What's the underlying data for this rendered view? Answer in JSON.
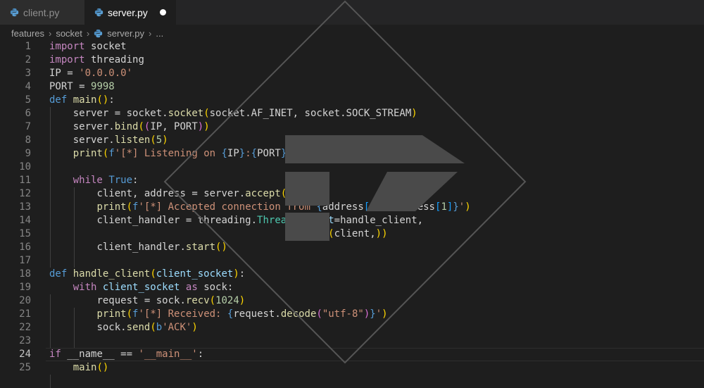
{
  "tabs": [
    {
      "label": "client.py",
      "active": false,
      "icon": "python-icon"
    },
    {
      "label": "server.py",
      "active": true,
      "icon": "python-icon",
      "unsaved": true
    }
  ],
  "breadcrumb": [
    "features",
    "socket",
    "server.py",
    "..."
  ],
  "current_line": 24,
  "colors": {
    "keyword": "#c586c0",
    "def": "#569cd6",
    "function": "#dcdcaa",
    "string": "#ce9178",
    "number": "#b5cea8"
  },
  "lines": [
    {
      "n": "1",
      "text": "import socket"
    },
    {
      "n": "2",
      "text": "import threading"
    },
    {
      "n": "3",
      "text": "IP = '0.0.0.0'"
    },
    {
      "n": "4",
      "text": "PORT = 9998"
    },
    {
      "n": "5",
      "text": "def main():"
    },
    {
      "n": "6",
      "text": "    server = socket.socket(socket.AF_INET, socket.SOCK_STREAM)"
    },
    {
      "n": "7",
      "text": "    server.bind((IP, PORT))"
    },
    {
      "n": "8",
      "text": "    server.listen(5)"
    },
    {
      "n": "9",
      "text": "    print(f'[*] Listening on {IP}:{PORT}')"
    },
    {
      "n": "10",
      "text": ""
    },
    {
      "n": "11",
      "text": "    while True:"
    },
    {
      "n": "12",
      "text": "        client, address = server.accept()"
    },
    {
      "n": "13",
      "text": "        print(f'[*] Accepted connection from {address[0]}{address[1]}')"
    },
    {
      "n": "14",
      "text": "        client_handler = threading.Thread(target=handle_client,"
    },
    {
      "n": "15",
      "text": "                                          args=(client,))"
    },
    {
      "n": "16",
      "text": "        client_handler.start()"
    },
    {
      "n": "17",
      "text": ""
    },
    {
      "n": "18",
      "text": "def handle_client(client_socket):"
    },
    {
      "n": "19",
      "text": "    with client_socket as sock:"
    },
    {
      "n": "20",
      "text": "        request = sock.recv(1024)"
    },
    {
      "n": "21",
      "text": "        print(f'[*] Received: {request.decode(\"utf-8\")}')"
    },
    {
      "n": "22",
      "text": "        sock.send(b'ACK')"
    },
    {
      "n": "23",
      "text": ""
    },
    {
      "n": "24",
      "text": "if __name__ == '__main__':"
    },
    {
      "n": "25",
      "text": "    main()"
    }
  ]
}
